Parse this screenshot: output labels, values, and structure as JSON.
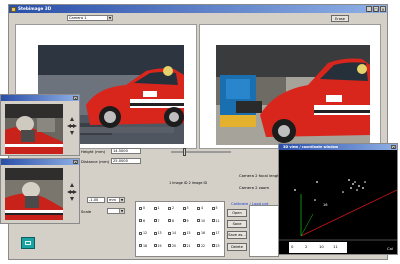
{
  "main_window": {
    "title": "Stebimage 3D",
    "camera_select": "Camera 1",
    "right_button": "Erase",
    "close_glyph": "×",
    "minimize_glyph": "_",
    "maximize_glyph": "□"
  },
  "controls": {
    "height_label": "Height (mm)",
    "height_value": "14.5000",
    "distance_label": "Distance (mm)",
    "distance_value": "25.0000",
    "field3_value": "-1.00",
    "field3_unit": "mm",
    "scale_label": "Scale",
    "slider_labels": [
      "0",
      "1"
    ],
    "image_ids_label": "1 Image ID  2 Image ID",
    "cam2_focal_label": "Camera 2 focal length",
    "cam2_zoom_label": "Camera 2 zoom",
    "blue_link": "Calibrate / Load pnt",
    "buttons": [
      "Open",
      "Save",
      "Save as...",
      "Delete"
    ],
    "grid_items": [
      "0",
      "1",
      "2",
      "3",
      "4",
      "5",
      "6",
      "7",
      "8",
      "9",
      "10",
      "11",
      "12",
      "13",
      "14",
      "15",
      "16",
      "17",
      "18",
      "19",
      "20",
      "21",
      "22",
      "23"
    ]
  },
  "scope_window": {
    "title": "3D view / coordinate window",
    "axis_ticks": [
      "0",
      "2",
      "10",
      "11"
    ],
    "corner_label": "Cal",
    "point_label": "16"
  },
  "colors": {
    "titlebar": "#2a4fa8",
    "chrome": "#d4d0c8",
    "accent_teal": "#1aa3a3",
    "car_red": "#d9261c"
  },
  "icons": {
    "app": "stebimage-app-icon",
    "nav": "navigation-cross-icon",
    "teal_tool": "teal-tool-icon"
  }
}
